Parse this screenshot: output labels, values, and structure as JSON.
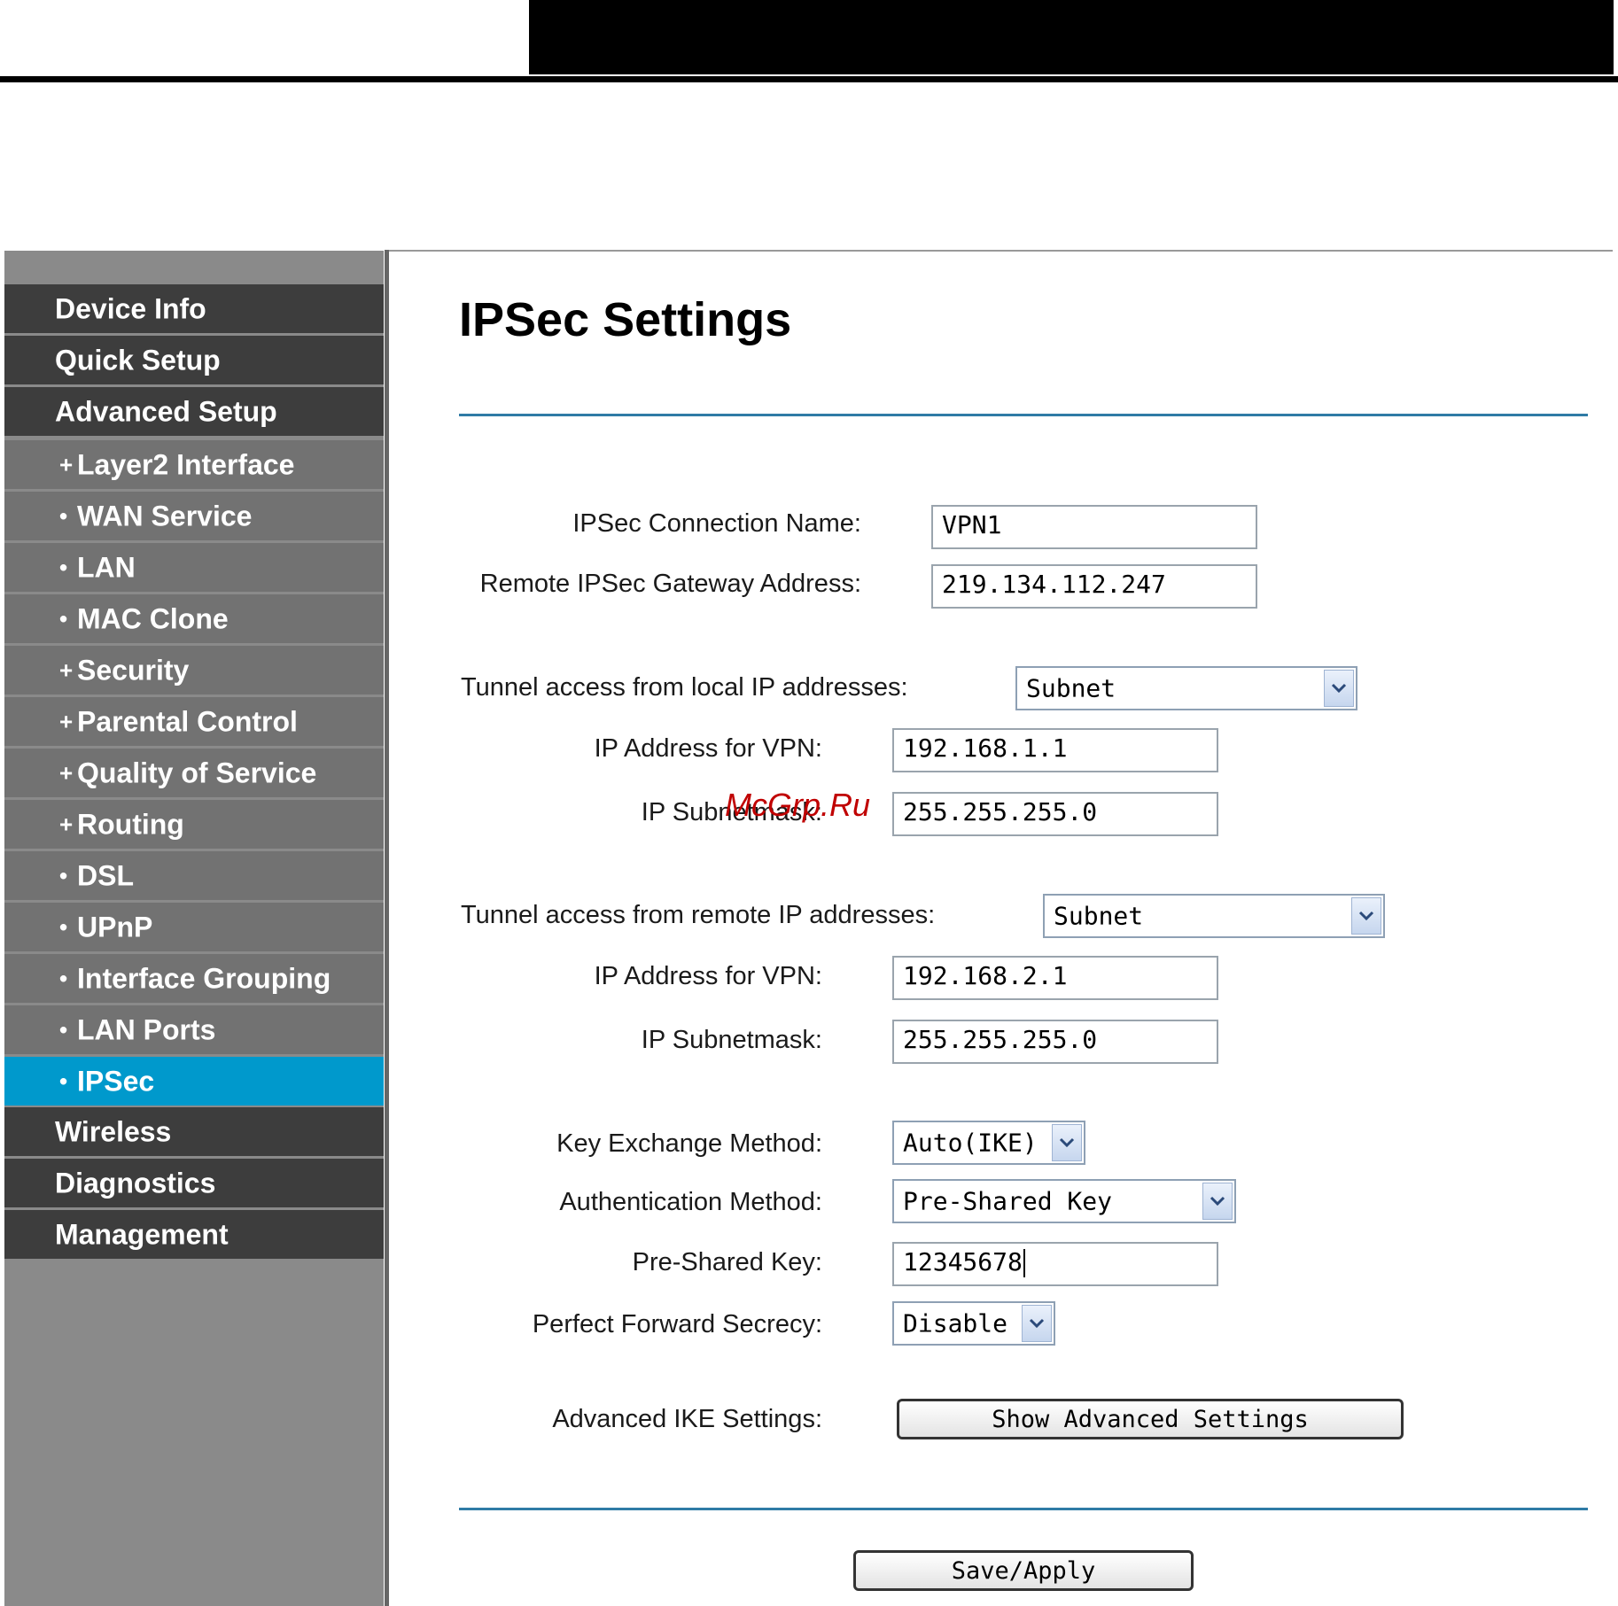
{
  "sidebar": {
    "items": [
      {
        "label": "Device Info",
        "level": "top"
      },
      {
        "label": "Quick Setup",
        "level": "top"
      },
      {
        "label": "Advanced Setup",
        "level": "top"
      },
      {
        "label": "Layer2 Interface",
        "level": "sub",
        "bullet": "+"
      },
      {
        "label": "WAN Service",
        "level": "sub",
        "bullet": "•"
      },
      {
        "label": "LAN",
        "level": "sub",
        "bullet": "•"
      },
      {
        "label": "MAC Clone",
        "level": "sub",
        "bullet": "•"
      },
      {
        "label": "Security",
        "level": "sub",
        "bullet": "+"
      },
      {
        "label": "Parental Control",
        "level": "sub",
        "bullet": "+"
      },
      {
        "label": "Quality of Service",
        "level": "sub",
        "bullet": "+"
      },
      {
        "label": "Routing",
        "level": "sub",
        "bullet": "+"
      },
      {
        "label": "DSL",
        "level": "sub",
        "bullet": "•"
      },
      {
        "label": "UPnP",
        "level": "sub",
        "bullet": "•"
      },
      {
        "label": "Interface Grouping",
        "level": "sub",
        "bullet": "•"
      },
      {
        "label": "LAN Ports",
        "level": "sub",
        "bullet": "•"
      },
      {
        "label": "IPSec",
        "level": "sub",
        "bullet": "•",
        "active": true
      },
      {
        "label": "Wireless",
        "level": "top"
      },
      {
        "label": "Diagnostics",
        "level": "top"
      },
      {
        "label": "Management",
        "level": "top"
      }
    ]
  },
  "page": {
    "title": "IPSec Settings"
  },
  "form": {
    "conn_name_label": "IPSec Connection Name:",
    "conn_name_value": "VPN1",
    "gateway_label": "Remote IPSec Gateway Address:",
    "gateway_value": "219.134.112.247",
    "local_access_label": "Tunnel access from local IP addresses:",
    "local_access_value": "Subnet",
    "local_ip_label": "IP Address for VPN:",
    "local_ip_value": "192.168.1.1",
    "local_mask_label": "IP Subnetmask:",
    "local_mask_value": "255.255.255.0",
    "remote_access_label": "Tunnel access from remote IP addresses:",
    "remote_access_value": "Subnet",
    "remote_ip_label": "IP Address for VPN:",
    "remote_ip_value": "192.168.2.1",
    "remote_mask_label": "IP Subnetmask:",
    "remote_mask_value": "255.255.255.0",
    "key_exchange_label": "Key Exchange Method:",
    "key_exchange_value": "Auto(IKE)",
    "auth_method_label": "Authentication Method:",
    "auth_method_value": "Pre-Shared Key",
    "psk_label": "Pre-Shared Key:",
    "psk_value": "12345678",
    "pfs_label": "Perfect Forward Secrecy:",
    "pfs_value": "Disable",
    "adv_ike_label": "Advanced IKE Settings:",
    "show_adv_button": "Show Advanced Settings",
    "save_button": "Save/Apply"
  },
  "watermark": "McGrp.Ru",
  "colors": {
    "nav_dark": "#3d3d3d",
    "nav_sub": "#727272",
    "nav_active": "#0099cc",
    "rule_blue": "#2f7ba6"
  }
}
